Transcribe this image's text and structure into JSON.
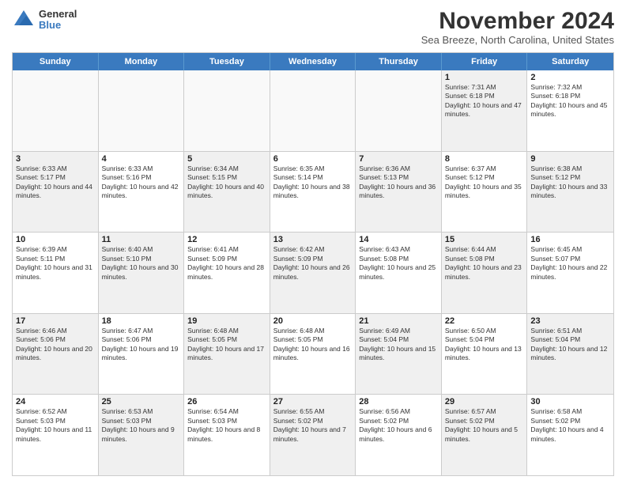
{
  "logo": {
    "general": "General",
    "blue": "Blue"
  },
  "title": "November 2024",
  "location": "Sea Breeze, North Carolina, United States",
  "weekdays": [
    "Sunday",
    "Monday",
    "Tuesday",
    "Wednesday",
    "Thursday",
    "Friday",
    "Saturday"
  ],
  "weeks": [
    [
      {
        "day": "",
        "info": "",
        "empty": true
      },
      {
        "day": "",
        "info": "",
        "empty": true
      },
      {
        "day": "",
        "info": "",
        "empty": true
      },
      {
        "day": "",
        "info": "",
        "empty": true
      },
      {
        "day": "",
        "info": "",
        "empty": true
      },
      {
        "day": "1",
        "info": "Sunrise: 7:31 AM\nSunset: 6:18 PM\nDaylight: 10 hours and 47 minutes.",
        "shaded": true
      },
      {
        "day": "2",
        "info": "Sunrise: 7:32 AM\nSunset: 6:18 PM\nDaylight: 10 hours and 45 minutes.",
        "shaded": false
      }
    ],
    [
      {
        "day": "3",
        "info": "Sunrise: 6:33 AM\nSunset: 5:17 PM\nDaylight: 10 hours and 44 minutes.",
        "shaded": true
      },
      {
        "day": "4",
        "info": "Sunrise: 6:33 AM\nSunset: 5:16 PM\nDaylight: 10 hours and 42 minutes.",
        "shaded": false
      },
      {
        "day": "5",
        "info": "Sunrise: 6:34 AM\nSunset: 5:15 PM\nDaylight: 10 hours and 40 minutes.",
        "shaded": true
      },
      {
        "day": "6",
        "info": "Sunrise: 6:35 AM\nSunset: 5:14 PM\nDaylight: 10 hours and 38 minutes.",
        "shaded": false
      },
      {
        "day": "7",
        "info": "Sunrise: 6:36 AM\nSunset: 5:13 PM\nDaylight: 10 hours and 36 minutes.",
        "shaded": true
      },
      {
        "day": "8",
        "info": "Sunrise: 6:37 AM\nSunset: 5:12 PM\nDaylight: 10 hours and 35 minutes.",
        "shaded": false
      },
      {
        "day": "9",
        "info": "Sunrise: 6:38 AM\nSunset: 5:12 PM\nDaylight: 10 hours and 33 minutes.",
        "shaded": true
      }
    ],
    [
      {
        "day": "10",
        "info": "Sunrise: 6:39 AM\nSunset: 5:11 PM\nDaylight: 10 hours and 31 minutes.",
        "shaded": false
      },
      {
        "day": "11",
        "info": "Sunrise: 6:40 AM\nSunset: 5:10 PM\nDaylight: 10 hours and 30 minutes.",
        "shaded": true
      },
      {
        "day": "12",
        "info": "Sunrise: 6:41 AM\nSunset: 5:09 PM\nDaylight: 10 hours and 28 minutes.",
        "shaded": false
      },
      {
        "day": "13",
        "info": "Sunrise: 6:42 AM\nSunset: 5:09 PM\nDaylight: 10 hours and 26 minutes.",
        "shaded": true
      },
      {
        "day": "14",
        "info": "Sunrise: 6:43 AM\nSunset: 5:08 PM\nDaylight: 10 hours and 25 minutes.",
        "shaded": false
      },
      {
        "day": "15",
        "info": "Sunrise: 6:44 AM\nSunset: 5:08 PM\nDaylight: 10 hours and 23 minutes.",
        "shaded": true
      },
      {
        "day": "16",
        "info": "Sunrise: 6:45 AM\nSunset: 5:07 PM\nDaylight: 10 hours and 22 minutes.",
        "shaded": false
      }
    ],
    [
      {
        "day": "17",
        "info": "Sunrise: 6:46 AM\nSunset: 5:06 PM\nDaylight: 10 hours and 20 minutes.",
        "shaded": true
      },
      {
        "day": "18",
        "info": "Sunrise: 6:47 AM\nSunset: 5:06 PM\nDaylight: 10 hours and 19 minutes.",
        "shaded": false
      },
      {
        "day": "19",
        "info": "Sunrise: 6:48 AM\nSunset: 5:05 PM\nDaylight: 10 hours and 17 minutes.",
        "shaded": true
      },
      {
        "day": "20",
        "info": "Sunrise: 6:48 AM\nSunset: 5:05 PM\nDaylight: 10 hours and 16 minutes.",
        "shaded": false
      },
      {
        "day": "21",
        "info": "Sunrise: 6:49 AM\nSunset: 5:04 PM\nDaylight: 10 hours and 15 minutes.",
        "shaded": true
      },
      {
        "day": "22",
        "info": "Sunrise: 6:50 AM\nSunset: 5:04 PM\nDaylight: 10 hours and 13 minutes.",
        "shaded": false
      },
      {
        "day": "23",
        "info": "Sunrise: 6:51 AM\nSunset: 5:04 PM\nDaylight: 10 hours and 12 minutes.",
        "shaded": true
      }
    ],
    [
      {
        "day": "24",
        "info": "Sunrise: 6:52 AM\nSunset: 5:03 PM\nDaylight: 10 hours and 11 minutes.",
        "shaded": false
      },
      {
        "day": "25",
        "info": "Sunrise: 6:53 AM\nSunset: 5:03 PM\nDaylight: 10 hours and 9 minutes.",
        "shaded": true
      },
      {
        "day": "26",
        "info": "Sunrise: 6:54 AM\nSunset: 5:03 PM\nDaylight: 10 hours and 8 minutes.",
        "shaded": false
      },
      {
        "day": "27",
        "info": "Sunrise: 6:55 AM\nSunset: 5:02 PM\nDaylight: 10 hours and 7 minutes.",
        "shaded": true
      },
      {
        "day": "28",
        "info": "Sunrise: 6:56 AM\nSunset: 5:02 PM\nDaylight: 10 hours and 6 minutes.",
        "shaded": false
      },
      {
        "day": "29",
        "info": "Sunrise: 6:57 AM\nSunset: 5:02 PM\nDaylight: 10 hours and 5 minutes.",
        "shaded": true
      },
      {
        "day": "30",
        "info": "Sunrise: 6:58 AM\nSunset: 5:02 PM\nDaylight: 10 hours and 4 minutes.",
        "shaded": false
      }
    ]
  ]
}
